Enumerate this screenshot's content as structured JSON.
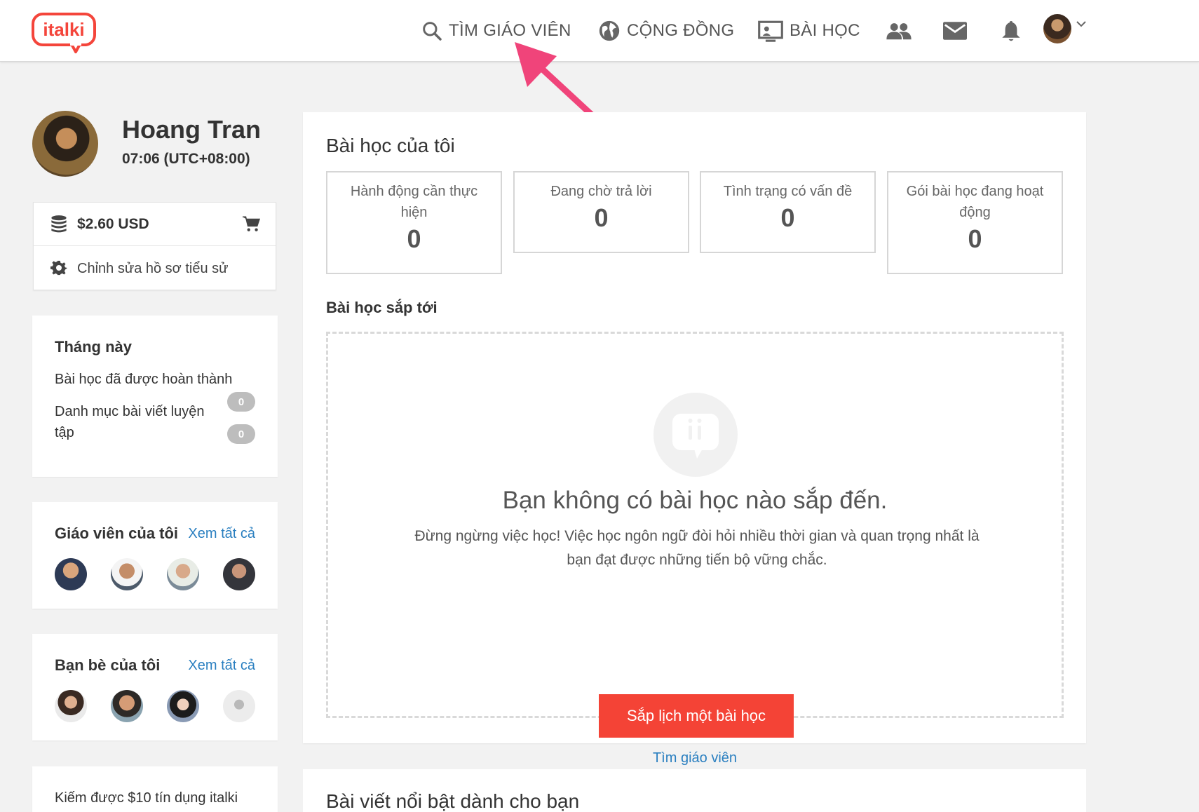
{
  "header": {
    "logo_text": "italki",
    "brand_color": "#f4453b",
    "nav": {
      "find_teacher": "TÌM GIÁO VIÊN",
      "community": "CỘNG ĐỒNG",
      "lessons": "BÀI HỌC"
    },
    "icons": [
      "people-icon",
      "mail-icon",
      "bell-icon",
      "chevron-down-icon"
    ]
  },
  "profile": {
    "name": "Hoang Tran",
    "time": "07:06 (UTC+08:00)"
  },
  "wallet": {
    "balance": "$2.60 USD",
    "edit_profile": "Chỉnh sửa hồ sơ tiểu sử"
  },
  "this_month": {
    "title": "Tháng này",
    "completed_label": "Bài học đã được hoàn thành",
    "practice_label_1": "Danh mục bài viết luyện",
    "practice_label_2": "tập",
    "completed_count": "0",
    "practice_count": "0"
  },
  "teachers": {
    "title": "Giáo viên của tôi",
    "see_all": "Xem tất cả"
  },
  "friends": {
    "title": "Bạn bè của tôi",
    "see_all": "Xem tất cả"
  },
  "earn": {
    "text": "Kiếm được $10 tín dụng italki"
  },
  "main": {
    "title": "Bài học của tôi",
    "stats": [
      {
        "label": "Hành động cần thực hiện",
        "value": "0"
      },
      {
        "label": "Đang chờ trả lời",
        "value": "0"
      },
      {
        "label": "Tình trạng có vấn đề",
        "value": "0"
      },
      {
        "label": "Gói bài học đang hoạt động",
        "value": "0"
      }
    ],
    "upcoming_title": "Bài học sắp tới",
    "empty_title": "Bạn không có bài học nào sắp đến.",
    "empty_desc_1": "Đừng ngừng việc học! Việc học ngôn ngữ đòi hỏi nhiều thời gian và quan trọng nhất là",
    "empty_desc_2": "bạn đạt được những tiến bộ vững chắc.",
    "cta": "Sắp lịch một bài học",
    "find_teacher_link": "Tìm giáo viên",
    "cta_color": "#f44336",
    "link_color": "#2a7fc0"
  },
  "featured": {
    "title": "Bài viết nổi bật dành cho bạn"
  },
  "annotation_color": "#f0447a"
}
